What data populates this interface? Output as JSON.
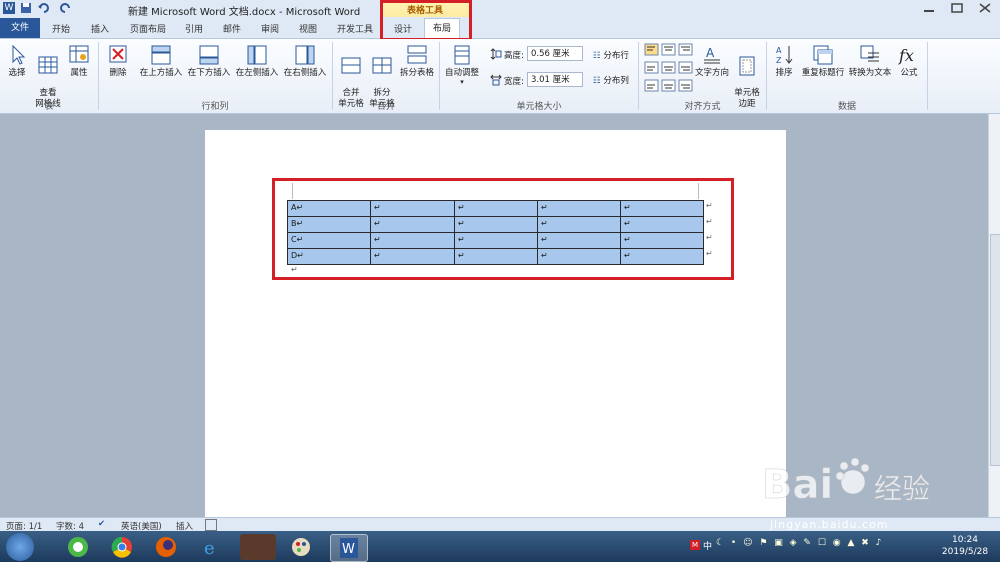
{
  "window": {
    "title": "新建 Microsoft Word 文档.docx - Microsoft Word"
  },
  "contextual_group": {
    "label": "表格工具"
  },
  "tabs": [
    "开始",
    "插入",
    "页面布局",
    "引用",
    "邮件",
    "审阅",
    "视图",
    "开发工具",
    "设计",
    "布局"
  ],
  "file_tab": "文件",
  "ribbon": {
    "groups": {
      "table": {
        "label": "表",
        "buttons": [
          "选择",
          "查看\n网格线",
          "属性"
        ]
      },
      "rows_cols": {
        "label": "行和列",
        "buttons": [
          "删除",
          "在上方插入",
          "在下方插入",
          "在左侧插入",
          "在右侧插入"
        ]
      },
      "merge": {
        "label": "合并",
        "buttons": [
          "合并\n单元格",
          "拆分\n单元格",
          "拆分表格"
        ]
      },
      "cell_size": {
        "label": "单元格大小",
        "autofit": "自动调整",
        "height_label": "高度:",
        "height_value": "0.56 厘米",
        "width_label": "宽度:",
        "width_value": "3.01 厘米",
        "dist_rows": "分布行",
        "dist_cols": "分布列"
      },
      "align": {
        "label": "对齐方式",
        "text_dir": "文字方向",
        "margins": "单元格\n边距"
      },
      "data": {
        "label": "数据",
        "buttons": [
          "排序",
          "重复标题行",
          "转换为文本",
          "公式"
        ]
      }
    }
  },
  "table": {
    "rows": [
      [
        "A↵",
        "↵",
        "↵",
        "↵",
        "↵"
      ],
      [
        "B↵",
        "↵",
        "↵",
        "↵",
        "↵"
      ],
      [
        "C↵",
        "↵",
        "↵",
        "↵",
        "↵"
      ],
      [
        "D↵",
        "↵",
        "↵",
        "↵",
        "↵"
      ]
    ],
    "end_marks": [
      "↵",
      "↵",
      "↵",
      "↵"
    ],
    "after_mark": "↵"
  },
  "status": {
    "page": "页面: 1/1",
    "words": "字数: 4",
    "lang": "英语(美国)",
    "mode": "插入"
  },
  "clock": {
    "time": "10:24",
    "date": "2019/5/28"
  },
  "tray": {
    "ime": "中"
  },
  "watermark": {
    "brand": "Bai",
    "brand2": "经验",
    "url": "jingyan.baidu.com"
  },
  "colors": {
    "accent": "#2a579a",
    "highlight": "#d41f26",
    "selection": "#a7c8ec"
  }
}
